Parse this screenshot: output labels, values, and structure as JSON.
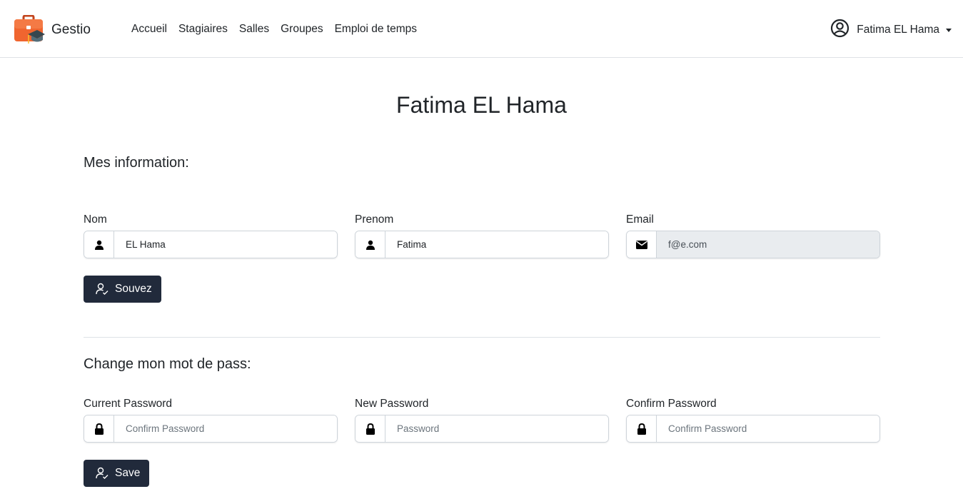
{
  "navbar": {
    "brand": "Gestio",
    "links": [
      "Accueil",
      "Stagiaires",
      "Salles",
      "Groupes",
      "Emploi de temps"
    ],
    "user_name": "Fatima EL Hama",
    "user_icon": "user-circle-icon"
  },
  "page_title": "Fatima EL Hama",
  "info_section": {
    "title": "Mes information:",
    "nom": {
      "label": "Nom",
      "value": "EL Hama",
      "icon": "user-icon"
    },
    "prenom": {
      "label": "Prenom",
      "value": "Fatima",
      "icon": "user-icon"
    },
    "email": {
      "label": "Email",
      "value": "f@e.com",
      "icon": "envelope-icon"
    },
    "save_button": "Souvez"
  },
  "password_section": {
    "title": "Change mon mot de pass:",
    "current": {
      "label": "Current Password",
      "placeholder": "Confirm Password",
      "icon": "lock-icon"
    },
    "new": {
      "label": "New Password",
      "placeholder": "Password",
      "icon": "lock-icon"
    },
    "confirm": {
      "label": "Confirm Password",
      "placeholder": "Confirm Password",
      "icon": "lock-icon"
    },
    "save_button": "Save"
  },
  "colors": {
    "button_bg": "#212a3b",
    "logo_orange": "#f0652f",
    "readonly_bg": "#e9ecef"
  }
}
